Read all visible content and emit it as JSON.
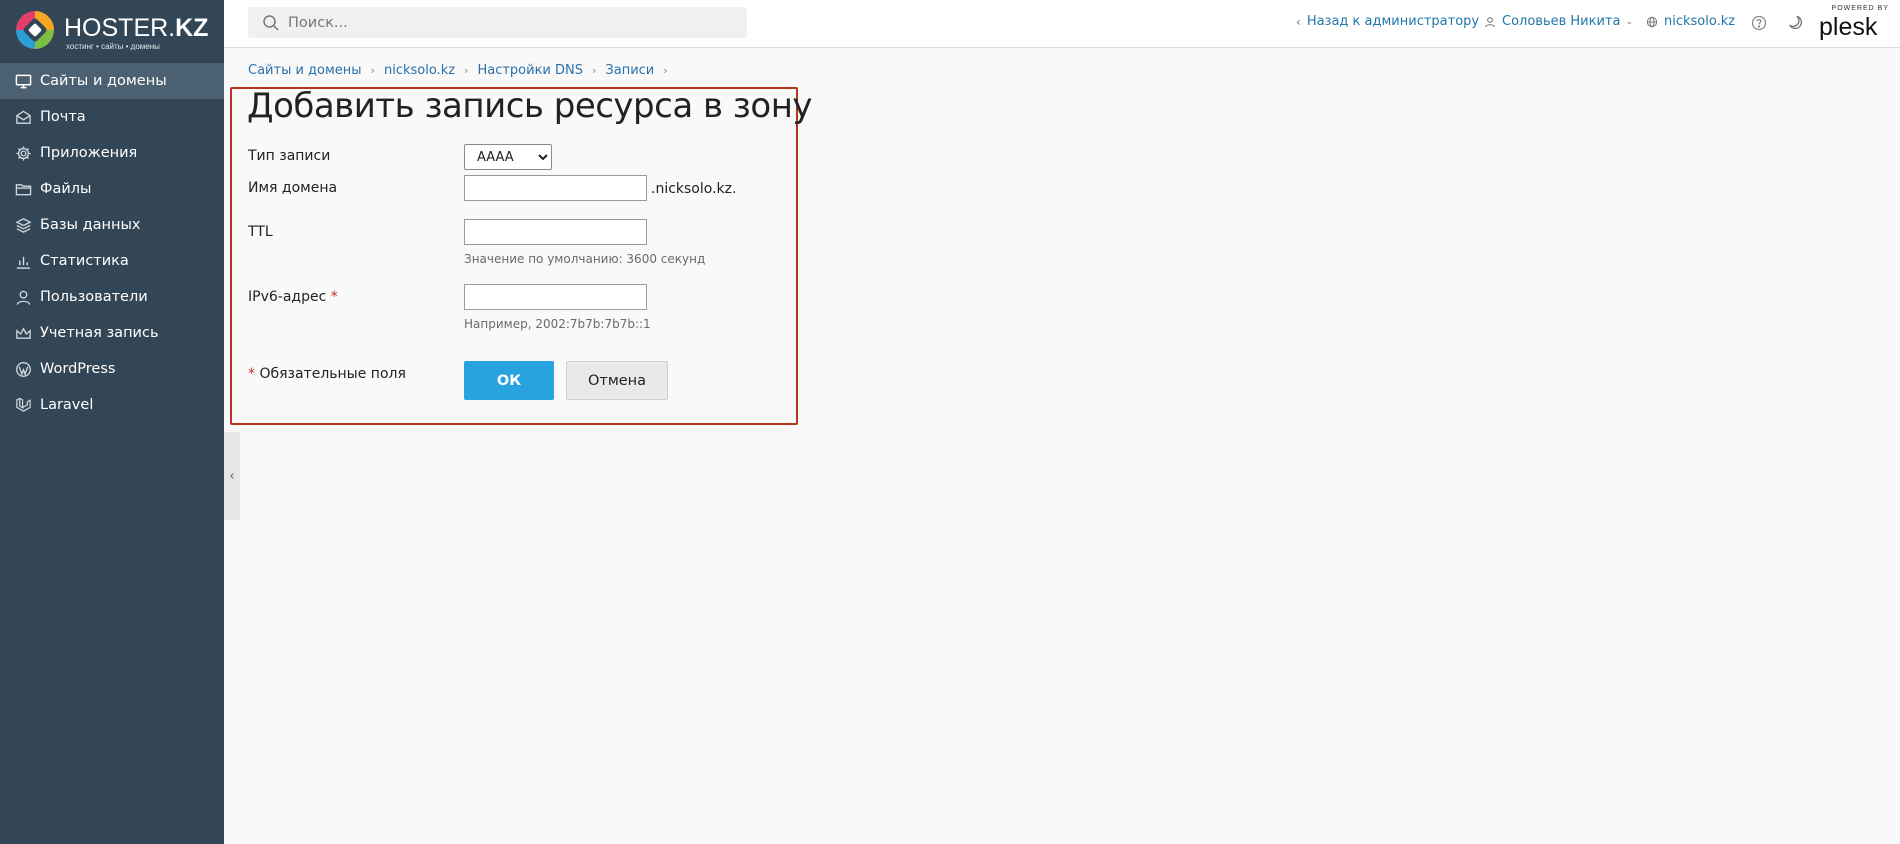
{
  "brand": {
    "name_main": "HOSTER.",
    "name_accent": "KZ",
    "tagline": "хостинг • сайты • домены"
  },
  "search": {
    "placeholder": "Поиск..."
  },
  "header": {
    "back_to_admin": "Назад к администратору",
    "user": "Соловьев Никита",
    "domain": "nicksolo.kz",
    "plesk_small": "POWERED BY",
    "plesk_word": "plesk"
  },
  "sidebar": {
    "items": [
      {
        "label": "Сайты и домены",
        "icon": "monitor-icon"
      },
      {
        "label": "Почта",
        "icon": "mail-icon"
      },
      {
        "label": "Приложения",
        "icon": "gear-icon"
      },
      {
        "label": "Файлы",
        "icon": "folder-icon"
      },
      {
        "label": "Базы данных",
        "icon": "database-layers-icon"
      },
      {
        "label": "Статистика",
        "icon": "bar-chart-icon"
      },
      {
        "label": "Пользователи",
        "icon": "user-icon"
      },
      {
        "label": "Учетная запись",
        "icon": "crown-icon"
      },
      {
        "label": "WordPress",
        "icon": "wordpress-icon"
      },
      {
        "label": "Laravel",
        "icon": "laravel-icon"
      }
    ],
    "active_index": 0
  },
  "breadcrumb": [
    "Сайты и домены",
    "nicksolo.kz",
    "Настройки DNS",
    "Записи"
  ],
  "form": {
    "title": "Добавить запись ресурса в зону",
    "record_type_label": "Тип записи",
    "record_type_value": "AAAA",
    "domain_name_label": "Имя домена",
    "domain_name_value": "",
    "domain_suffix": ".nicksolo.kz.",
    "ttl_label": "TTL",
    "ttl_value": "",
    "ttl_hint": "Значение по умолчанию: 3600 секунд",
    "ipv6_label": "IPv6-адрес",
    "ipv6_value": "",
    "ipv6_hint": "Например, 2002:7b7b:7b7b::1",
    "required_mark": "*",
    "required_note": "Обязательные поля",
    "ok_label": "ОК",
    "cancel_label": "Отмена"
  },
  "colors": {
    "sidebar_bg": "#334655",
    "sidebar_active": "#4b6171",
    "link": "#2a70a8",
    "primary_button": "#28a3df",
    "highlight_frame": "#b5361c"
  }
}
